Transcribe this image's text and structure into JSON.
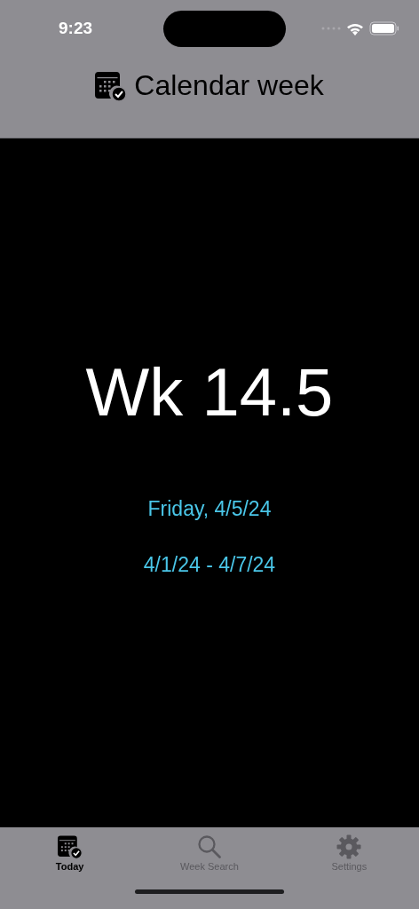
{
  "status_bar": {
    "time": "9:23"
  },
  "nav_bar": {
    "title": "Calendar week"
  },
  "content": {
    "week": "Wk 14.5",
    "date": "Friday, 4/5/24",
    "range": "4/1/24 - 4/7/24"
  },
  "tab_bar": [
    {
      "label": "Today",
      "kind": "calendar",
      "selected": true
    },
    {
      "label": "Week Search",
      "kind": "search",
      "selected": false
    },
    {
      "label": "Settings",
      "kind": "gear",
      "selected": false
    }
  ]
}
